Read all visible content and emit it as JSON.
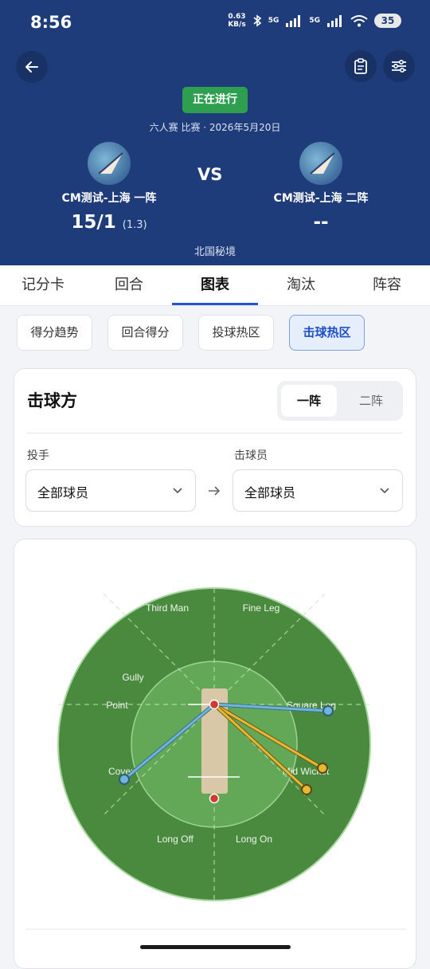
{
  "status": {
    "time": "8:56",
    "speed_value": "0.63",
    "speed_unit": "KB/s",
    "net1": "5G",
    "net2": "5G",
    "battery": "35"
  },
  "header": {
    "badge": "正在进行",
    "match_info": "六人赛 比赛 · 2026年5月20日",
    "vs": "VS",
    "venue": "北国秘境",
    "team_a": {
      "name": "CM测试-上海 一阵",
      "score": "15/1",
      "overs": "(1.3)"
    },
    "team_b": {
      "name": "CM测试-上海 二阵",
      "score": "--"
    }
  },
  "tabs": [
    "记分卡",
    "回合",
    "图表",
    "淘汰",
    "阵容"
  ],
  "active_tab": "图表",
  "subtabs": [
    "得分趋势",
    "回合得分",
    "投球热区",
    "击球热区"
  ],
  "active_subtab": "击球热区",
  "filter_card": {
    "title": "击球方",
    "segments": [
      "一阵",
      "二阵"
    ],
    "active_segment": "一阵",
    "bowler_label": "投手",
    "bowler_value": "全部球员",
    "batter_label": "击球员",
    "batter_value": "全部球员"
  },
  "wagon_wheel": {
    "zones": [
      "Third Man",
      "Fine Leg",
      "Gully",
      "Point",
      "Square Leg",
      "Cover",
      "Mid Wicket",
      "Long Off",
      "Long On"
    ],
    "colors": {
      "outfield": "#4a8a3f",
      "infield": "#63a857",
      "pitch": "#d9c8a8",
      "line_blue": "#6fb5d9",
      "line_yellow": "#e8b833",
      "stump": "#d33a2f"
    }
  }
}
